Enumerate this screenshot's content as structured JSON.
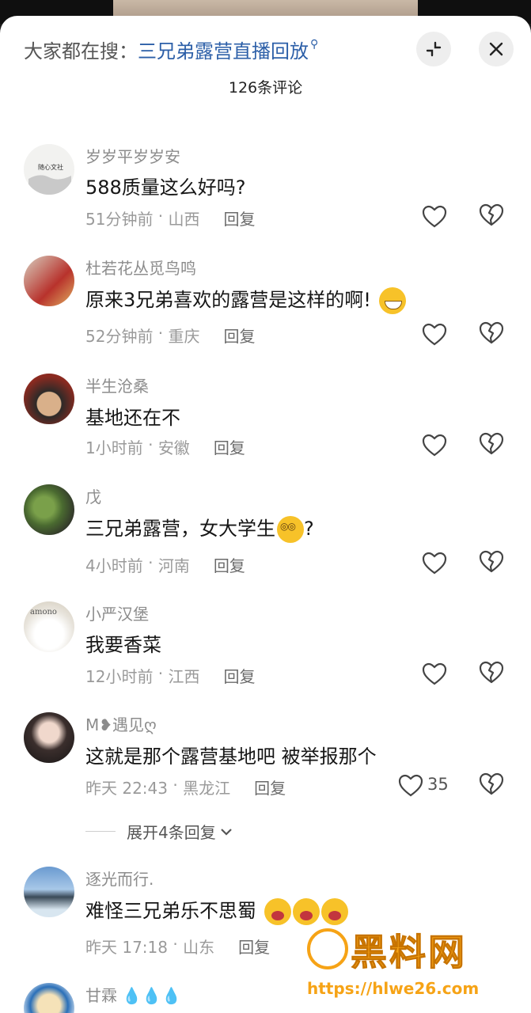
{
  "header": {
    "search_prefix": "大家都在搜：",
    "search_term": "三兄弟露营直播回放",
    "comment_count": "126条评论"
  },
  "icons": {
    "search": "search-icon",
    "collapse": "collapse-icon",
    "close": "close-icon",
    "like": "heart-outline-icon",
    "dislike": "broken-heart-icon"
  },
  "colors": {
    "search_term": "#2c5fa8",
    "watermark": "#f6a316"
  },
  "comments": [
    {
      "username": "岁岁平岁岁安",
      "text": "588质量这么好吗?",
      "time": "51分钟前",
      "location": "山西",
      "reply": "回复"
    },
    {
      "username": "杜若花丛觅鸟鸣",
      "text": "原来3兄弟喜欢的露营是这样的啊!",
      "time": "52分钟前",
      "location": "重庆",
      "reply": "回复"
    },
    {
      "username": "半生沧桑",
      "text": "基地还在不",
      "time": "1小时前",
      "location": "安徽",
      "reply": "回复"
    },
    {
      "username": "戊",
      "text": "三兄弟露营，女大学生",
      "text_suffix": "?",
      "time": "4小时前",
      "location": "河南",
      "reply": "回复"
    },
    {
      "username": "小严汉堡",
      "text": "我要香菜",
      "time": "12小时前",
      "location": "江西",
      "reply": "回复"
    },
    {
      "username": "M❥遇见ღ",
      "text": "这就是那个露营基地吧  被举报那个",
      "time": "昨天 22:43",
      "location": "黑龙江",
      "reply": "回复",
      "likes": "35"
    },
    {
      "username": "逐光而行.",
      "text": "难怪三兄弟乐不思蜀",
      "time": "昨天 17:18",
      "location": "山东",
      "reply": "回复"
    },
    {
      "username": "甘霖",
      "text": ""
    }
  ],
  "expand_replies": "展开4条回复",
  "watermark": {
    "title": "黑料网",
    "url": "https://hlwe26.com"
  },
  "avatar_captions": {
    "first": "随心文社",
    "fifth": "amono"
  }
}
